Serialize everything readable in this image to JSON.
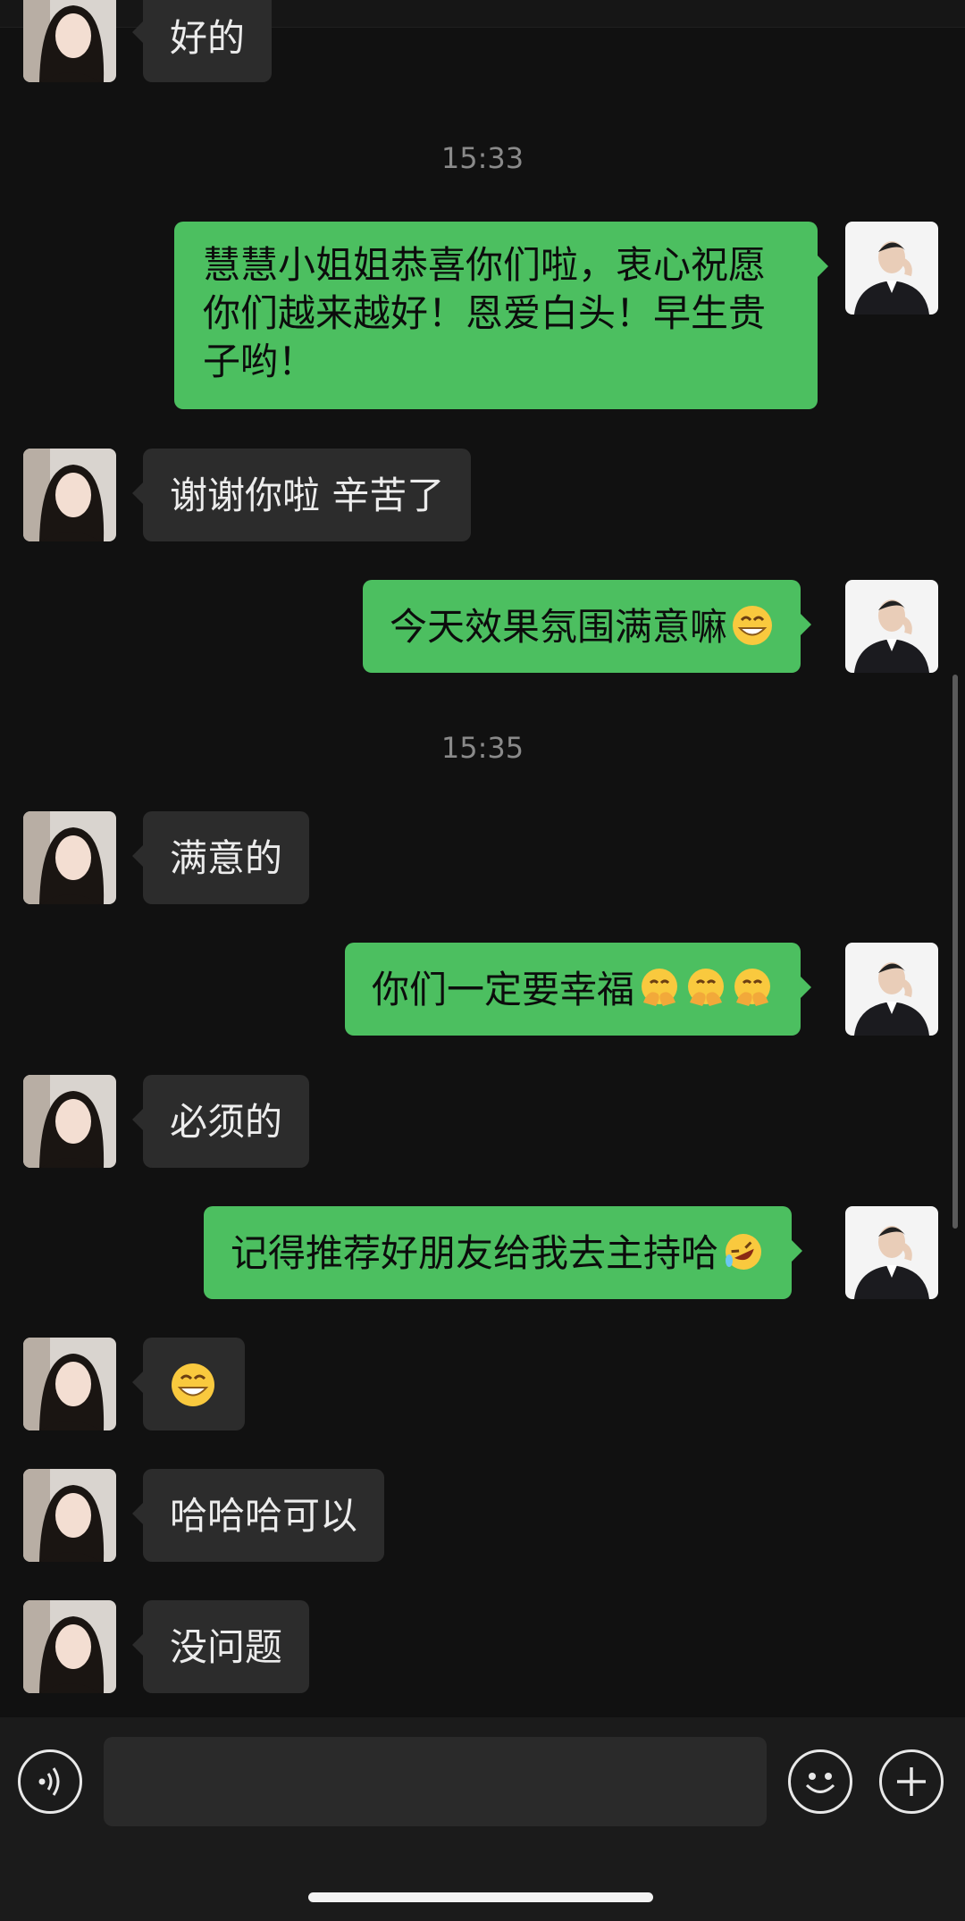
{
  "messages": [
    {
      "side": "left",
      "text": "好的"
    },
    {
      "type": "time",
      "text": "15:33"
    },
    {
      "side": "right",
      "lines": [
        "慧慧小姐姐恭喜你们啦，衷心祝愿",
        "你们越来越好！恩爱白头！早生贵",
        "子哟！"
      ]
    },
    {
      "side": "left",
      "text": "谢谢你啦 辛苦了"
    },
    {
      "side": "right",
      "text": "今天效果氛围满意嘛",
      "emojis": [
        "grin"
      ]
    },
    {
      "type": "time",
      "text": "15:35"
    },
    {
      "side": "left",
      "text": "满意的"
    },
    {
      "side": "right",
      "text": "你们一定要幸福",
      "emojis": [
        "shy",
        "shy",
        "shy"
      ]
    },
    {
      "side": "left",
      "text": "必须的"
    },
    {
      "side": "right",
      "text": "记得推荐好朋友给我去主持哈",
      "emojis": [
        "rofl"
      ]
    },
    {
      "side": "left",
      "text": "",
      "emojis": [
        "grin"
      ]
    },
    {
      "side": "left",
      "text": "哈哈哈可以"
    },
    {
      "side": "left",
      "text": "没问题"
    }
  ],
  "input_bar": {
    "voice_icon": "voice-icon",
    "emoji_icon": "smiley-icon",
    "plus_icon": "plus-icon"
  },
  "colors": {
    "background": "#111111",
    "bubble_in": "#2c2c2c",
    "bubble_out": "#4cbf60"
  }
}
